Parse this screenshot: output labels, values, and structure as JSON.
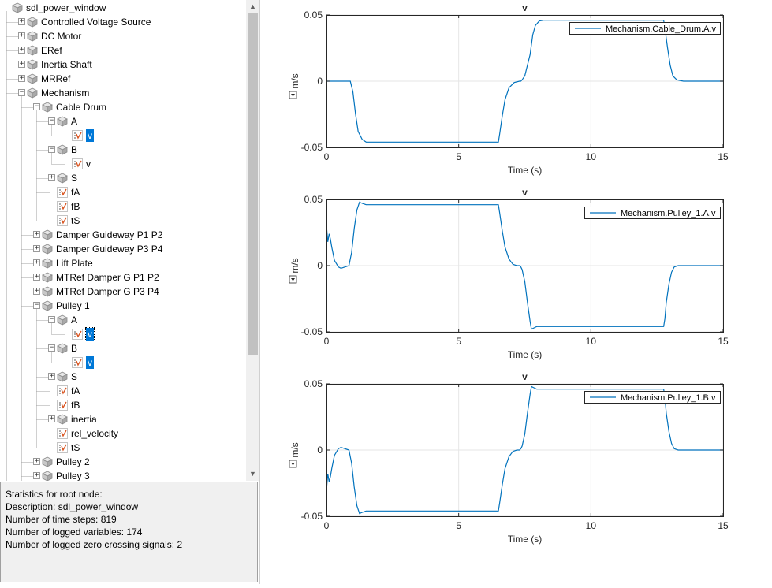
{
  "tree": {
    "items": [
      {
        "label": "sdl_power_window",
        "level": 0,
        "toggle": "none",
        "icon": "block"
      },
      {
        "label": "Controlled Voltage Source",
        "level": 1,
        "toggle": "plus",
        "icon": "block"
      },
      {
        "label": "DC Motor",
        "level": 1,
        "toggle": "plus",
        "icon": "block"
      },
      {
        "label": "ERef",
        "level": 1,
        "toggle": "plus",
        "icon": "block"
      },
      {
        "label": "Inertia Shaft",
        "level": 1,
        "toggle": "plus",
        "icon": "block"
      },
      {
        "label": "MRRef",
        "level": 1,
        "toggle": "plus",
        "icon": "block"
      },
      {
        "label": "Mechanism",
        "level": 1,
        "toggle": "minus",
        "icon": "block"
      },
      {
        "label": "Cable Drum",
        "level": 2,
        "toggle": "minus",
        "icon": "block"
      },
      {
        "label": "A",
        "level": 3,
        "toggle": "minus",
        "icon": "block"
      },
      {
        "label": "v",
        "level": 4,
        "toggle": "none",
        "icon": "signal",
        "selected": true
      },
      {
        "label": "B",
        "level": 3,
        "toggle": "minus",
        "icon": "block"
      },
      {
        "label": "v",
        "level": 4,
        "toggle": "none",
        "icon": "signal"
      },
      {
        "label": "S",
        "level": 3,
        "toggle": "plus",
        "icon": "block"
      },
      {
        "label": "fA",
        "level": 3,
        "toggle": "none",
        "icon": "signal"
      },
      {
        "label": "fB",
        "level": 3,
        "toggle": "none",
        "icon": "signal"
      },
      {
        "label": "tS",
        "level": 3,
        "toggle": "none",
        "icon": "signal"
      },
      {
        "label": "Damper Guideway P1 P2",
        "level": 2,
        "toggle": "plus",
        "icon": "block"
      },
      {
        "label": "Damper Guideway P3 P4",
        "level": 2,
        "toggle": "plus",
        "icon": "block"
      },
      {
        "label": "Lift Plate",
        "level": 2,
        "toggle": "plus",
        "icon": "block"
      },
      {
        "label": "MTRef Damper G P1 P2",
        "level": 2,
        "toggle": "plus",
        "icon": "block"
      },
      {
        "label": "MTRef Damper G P3 P4",
        "level": 2,
        "toggle": "plus",
        "icon": "block"
      },
      {
        "label": "Pulley 1",
        "level": 2,
        "toggle": "minus",
        "icon": "block"
      },
      {
        "label": "A",
        "level": 3,
        "toggle": "minus",
        "icon": "block"
      },
      {
        "label": "v",
        "level": 4,
        "toggle": "none",
        "icon": "signal",
        "selected": true,
        "focused": true
      },
      {
        "label": "B",
        "level": 3,
        "toggle": "minus",
        "icon": "block"
      },
      {
        "label": "v",
        "level": 4,
        "toggle": "none",
        "icon": "signal",
        "selected": true
      },
      {
        "label": "S",
        "level": 3,
        "toggle": "plus",
        "icon": "block"
      },
      {
        "label": "fA",
        "level": 3,
        "toggle": "none",
        "icon": "signal"
      },
      {
        "label": "fB",
        "level": 3,
        "toggle": "none",
        "icon": "signal"
      },
      {
        "label": "inertia",
        "level": 3,
        "toggle": "plus",
        "icon": "block"
      },
      {
        "label": "rel_velocity",
        "level": 3,
        "toggle": "none",
        "icon": "signal"
      },
      {
        "label": "tS",
        "level": 3,
        "toggle": "none",
        "icon": "signal"
      },
      {
        "label": "Pulley 2",
        "level": 2,
        "toggle": "plus",
        "icon": "block"
      },
      {
        "label": "Pulley 3",
        "level": 2,
        "toggle": "plus",
        "icon": "block"
      }
    ]
  },
  "stats": {
    "heading": "Statistics for root node:",
    "description": "Description: sdl_power_window",
    "time_steps": "Number of time steps: 819",
    "logged_variables": "Number of logged variables: 174",
    "zero_crossings": "Number of logged zero crossing signals: 2"
  },
  "colors": {
    "selection": "#0078d7",
    "trace": "#0072bd",
    "axes_bg": "#ffffff",
    "grid": "#e6e6e6",
    "scrollbar_thumb": "#c1c1c1"
  },
  "icons": {
    "block": "cube-icon",
    "signal": "signal-icon",
    "unit_menu": "dropdown-arrow-icon"
  },
  "chart_data": [
    {
      "type": "line",
      "title": "v",
      "xlabel": "Time (s)",
      "ylabel": "m/s",
      "xlim": [
        0,
        15
      ],
      "ylim": [
        -0.05,
        0.05
      ],
      "xticks": [
        "0",
        "5",
        "10",
        "15"
      ],
      "yticks": [
        "-0.05",
        "0",
        "0.05"
      ],
      "legend_position": "top-right",
      "grid": true,
      "series": [
        {
          "name": "Mechanism.Cable_Drum.A.v",
          "x": [
            0,
            0.9,
            1.0,
            1.1,
            1.2,
            1.35,
            1.5,
            1.7,
            6.5,
            6.55,
            6.65,
            6.75,
            6.9,
            7.1,
            7.3,
            7.35,
            7.4,
            7.5,
            7.7,
            7.8,
            7.9,
            8.05,
            8.2,
            8.5,
            12.75,
            12.8,
            12.9,
            13.0,
            13.1,
            13.25,
            13.5,
            15
          ],
          "y": [
            0,
            0,
            -0.008,
            -0.025,
            -0.038,
            -0.044,
            -0.046,
            -0.046,
            -0.046,
            -0.04,
            -0.026,
            -0.014,
            -0.005,
            -0.001,
            0,
            0,
            0.001,
            0.004,
            0.02,
            0.035,
            0.042,
            0.0455,
            0.046,
            0.046,
            0.046,
            0.04,
            0.025,
            0.012,
            0.004,
            0.001,
            0,
            0
          ]
        }
      ]
    },
    {
      "type": "line",
      "title": "v",
      "xlabel": "Time (s)",
      "ylabel": "m/s",
      "xlim": [
        0,
        15
      ],
      "ylim": [
        -0.05,
        0.05
      ],
      "xticks": [
        "0",
        "5",
        "10",
        "15"
      ],
      "yticks": [
        "-0.05",
        "0",
        "0.05"
      ],
      "legend_position": "top-right",
      "grid": true,
      "series": [
        {
          "name": "Mechanism.Pulley_1.A.v",
          "x": [
            0,
            0.05,
            0.1,
            0.15,
            0.2,
            0.3,
            0.45,
            0.55,
            0.7,
            0.85,
            0.95,
            1.05,
            1.15,
            1.25,
            1.35,
            1.5,
            1.8,
            6.5,
            6.55,
            6.65,
            6.75,
            6.9,
            7.05,
            7.2,
            7.3,
            7.35,
            7.4,
            7.5,
            7.6,
            7.7,
            7.75,
            7.85,
            7.95,
            8.1,
            8.3,
            12.75,
            12.8,
            12.85,
            12.95,
            13.05,
            13.15,
            13.3,
            13.6,
            15
          ],
          "y": [
            0.03,
            0.018,
            0.024,
            0.02,
            0.014,
            0.004,
            -0.001,
            -0.002,
            -0.001,
            0,
            0.01,
            0.028,
            0.042,
            0.048,
            0.047,
            0.046,
            0.046,
            0.046,
            0.04,
            0.026,
            0.014,
            0.005,
            0.001,
            0,
            0,
            -0.001,
            -0.003,
            -0.012,
            -0.028,
            -0.042,
            -0.048,
            -0.047,
            -0.046,
            -0.046,
            -0.046,
            -0.046,
            -0.04,
            -0.028,
            -0.014,
            -0.005,
            -0.001,
            0,
            0,
            0
          ]
        }
      ]
    },
    {
      "type": "line",
      "title": "v",
      "xlabel": "Time (s)",
      "ylabel": "m/s",
      "xlim": [
        0,
        15
      ],
      "ylim": [
        -0.05,
        0.05
      ],
      "xticks": [
        "0",
        "5",
        "10",
        "15"
      ],
      "yticks": [
        "-0.05",
        "0",
        "0.05"
      ],
      "legend_position": "top-right",
      "grid": true,
      "series": [
        {
          "name": "Mechanism.Pulley_1.B.v",
          "x": [
            0,
            0.05,
            0.1,
            0.15,
            0.2,
            0.3,
            0.45,
            0.55,
            0.7,
            0.85,
            0.95,
            1.05,
            1.15,
            1.25,
            1.35,
            1.5,
            1.8,
            6.5,
            6.55,
            6.65,
            6.75,
            6.9,
            7.05,
            7.2,
            7.3,
            7.35,
            7.4,
            7.5,
            7.6,
            7.7,
            7.75,
            7.85,
            7.95,
            8.1,
            8.3,
            12.75,
            12.8,
            12.85,
            12.95,
            13.05,
            13.15,
            13.3,
            13.6,
            15
          ],
          "y": [
            -0.03,
            -0.018,
            -0.024,
            -0.02,
            -0.014,
            -0.004,
            0.001,
            0.002,
            0.001,
            0,
            -0.01,
            -0.028,
            -0.042,
            -0.048,
            -0.047,
            -0.046,
            -0.046,
            -0.046,
            -0.04,
            -0.026,
            -0.014,
            -0.005,
            -0.001,
            0,
            0,
            0.001,
            0.003,
            0.012,
            0.028,
            0.042,
            0.048,
            0.047,
            0.046,
            0.046,
            0.046,
            0.046,
            0.04,
            0.028,
            0.014,
            0.005,
            0.001,
            0,
            0,
            0
          ]
        }
      ]
    }
  ]
}
